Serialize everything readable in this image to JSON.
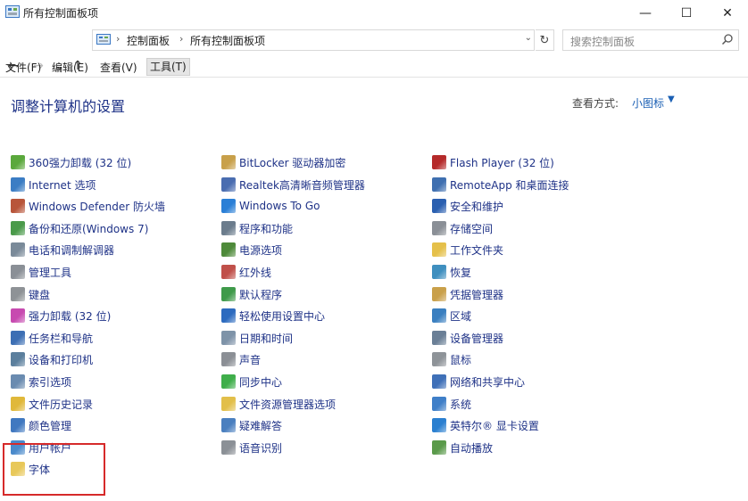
{
  "window": {
    "title": "所有控制面板项",
    "controls": {
      "minimize": "—",
      "maximize": "☐",
      "close": "✕"
    }
  },
  "nav": {
    "back": "←",
    "forward": "→",
    "recent": "⌄",
    "up": "↑"
  },
  "address": {
    "segments": [
      "控制面板",
      "所有控制面板项"
    ],
    "separator": "›",
    "dropdown": "⌄",
    "refresh": "↻"
  },
  "search": {
    "placeholder": "搜索控制面板"
  },
  "menus": [
    "文件(F)",
    "编辑(E)",
    "查看(V)",
    "工具(T)"
  ],
  "main": {
    "heading": "调整计算机的设置",
    "view_by_label": "查看方式:",
    "view_by_value": "小图标",
    "view_by_caret": "▼"
  },
  "columns": [
    [
      {
        "label": "360强力卸载 (32 位)",
        "icon": "uninstall-icon",
        "color": "#5aa83c"
      },
      {
        "label": "Internet 选项",
        "icon": "internet-options-icon",
        "color": "#3b7dc4"
      },
      {
        "label": "Windows Defender 防火墙",
        "icon": "firewall-icon",
        "color": "#b8553a"
      },
      {
        "label": "备份和还原(Windows 7)",
        "icon": "backup-icon",
        "color": "#4a9a4a"
      },
      {
        "label": "电话和调制解调器",
        "icon": "phone-modem-icon",
        "color": "#7a8a99"
      },
      {
        "label": "管理工具",
        "icon": "admin-tools-icon",
        "color": "#8a8f96"
      },
      {
        "label": "键盘",
        "icon": "keyboard-icon",
        "color": "#8e9296"
      },
      {
        "label": "强力卸载 (32 位)",
        "icon": "power-uninstall-icon",
        "color": "#c74ab0"
      },
      {
        "label": "任务栏和导航",
        "icon": "taskbar-icon",
        "color": "#3d6fb4"
      },
      {
        "label": "设备和打印机",
        "icon": "devices-printers-icon",
        "color": "#5b7f9d"
      },
      {
        "label": "索引选项",
        "icon": "indexing-icon",
        "color": "#6a8bb0"
      },
      {
        "label": "文件历史记录",
        "icon": "file-history-icon",
        "color": "#e0b83a"
      },
      {
        "label": "颜色管理",
        "icon": "color-management-icon",
        "color": "#4078c0"
      },
      {
        "label": "用户帐户",
        "icon": "user-accounts-icon",
        "color": "#4a8acb"
      },
      {
        "label": "字体",
        "icon": "fonts-icon",
        "color": "#e8c85a"
      }
    ],
    [
      {
        "label": "BitLocker 驱动器加密",
        "icon": "bitlocker-icon",
        "color": "#c8a04a"
      },
      {
        "label": "Realtek高清晰音频管理器",
        "icon": "realtek-audio-icon",
        "color": "#4a6db0"
      },
      {
        "label": "Windows To Go",
        "icon": "windows-to-go-icon",
        "color": "#2a7fd6"
      },
      {
        "label": "程序和功能",
        "icon": "programs-icon",
        "color": "#6b7c8c"
      },
      {
        "label": "电源选项",
        "icon": "power-options-icon",
        "color": "#4e8a3a"
      },
      {
        "label": "红外线",
        "icon": "infrared-icon",
        "color": "#c0504a"
      },
      {
        "label": "默认程序",
        "icon": "default-programs-icon",
        "color": "#3f9a4a"
      },
      {
        "label": "轻松使用设置中心",
        "icon": "ease-of-access-icon",
        "color": "#2d6bbf"
      },
      {
        "label": "日期和时间",
        "icon": "date-time-icon",
        "color": "#7e93a8"
      },
      {
        "label": "声音",
        "icon": "sound-icon",
        "color": "#8b8f95"
      },
      {
        "label": "同步中心",
        "icon": "sync-center-icon",
        "color": "#3fae4a"
      },
      {
        "label": "文件资源管理器选项",
        "icon": "explorer-options-icon",
        "color": "#e2bf4a"
      },
      {
        "label": "疑难解答",
        "icon": "troubleshooting-icon",
        "color": "#4a7fbf"
      },
      {
        "label": "语音识别",
        "icon": "speech-icon",
        "color": "#8b9096"
      }
    ],
    [
      {
        "label": "Flash Player (32 位)",
        "icon": "flash-icon",
        "color": "#b52a2a"
      },
      {
        "label": "RemoteApp 和桌面连接",
        "icon": "remoteapp-icon",
        "color": "#3f6fb0"
      },
      {
        "label": "安全和维护",
        "icon": "security-icon",
        "color": "#2a5fb0"
      },
      {
        "label": "存储空间",
        "icon": "storage-spaces-icon",
        "color": "#8a8f96"
      },
      {
        "label": "工作文件夹",
        "icon": "work-folders-icon",
        "color": "#e5c04a"
      },
      {
        "label": "恢复",
        "icon": "recovery-icon",
        "color": "#3f8fbf"
      },
      {
        "label": "凭据管理器",
        "icon": "credential-icon",
        "color": "#c9a04a"
      },
      {
        "label": "区域",
        "icon": "region-icon",
        "color": "#3a7fc0"
      },
      {
        "label": "设备管理器",
        "icon": "device-manager-icon",
        "color": "#6a7f96"
      },
      {
        "label": "鼠标",
        "icon": "mouse-icon",
        "color": "#8e9398"
      },
      {
        "label": "网络和共享中心",
        "icon": "network-icon",
        "color": "#3f70b8"
      },
      {
        "label": "系统",
        "icon": "system-icon",
        "color": "#3f7fc8"
      },
      {
        "label": "英特尔® 显卡设置",
        "icon": "intel-graphics-icon",
        "color": "#2a7fd0"
      },
      {
        "label": "自动播放",
        "icon": "autoplay-icon",
        "color": "#5a9a4a"
      }
    ]
  ]
}
